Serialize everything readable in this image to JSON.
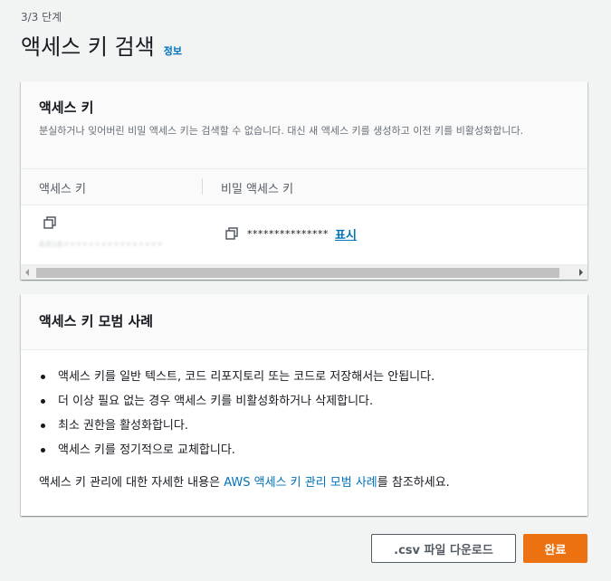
{
  "header": {
    "step": "3/3 단계",
    "title": "액세스 키 검색",
    "info_link": "정보"
  },
  "access_key_card": {
    "title": "액세스 키",
    "description": "분실하거나 잊어버린 비밀 액세스 키는 검색할 수 없습니다. 대신 새 액세스 키를 생성하고 이전 키를 비활성화합니다.",
    "columns": [
      "액세스 키",
      "비밀 액세스 키"
    ],
    "row": {
      "access_key": "AKIA••••••••••••••••",
      "secret_key_mask": "***************",
      "show_label": "표시"
    }
  },
  "best_practices_card": {
    "title": "액세스 키 모범 사례",
    "items": [
      "액세스 키를 일반 텍스트, 코드 리포지토리 또는 코드로 저장해서는 안됩니다.",
      "더 이상 필요 없는 경우 액세스 키를 비활성화하거나 삭제합니다.",
      "최소 권한을 활성화합니다.",
      "액세스 키를 정기적으로 교체합니다."
    ],
    "footer_prefix": "액세스 키 관리에 대한 자세한 내용은 ",
    "footer_link": "AWS 액세스 키 관리 모범 사례",
    "footer_suffix": "를 참조하세요."
  },
  "buttons": {
    "download_csv": ".csv 파일 다운로드",
    "done": "완료"
  },
  "icons": {
    "copy": "copy-icon",
    "scroll_left": "chevron-left-icon",
    "scroll_right": "chevron-right-icon"
  },
  "colors": {
    "link": "#0073bb",
    "primary_button": "#ec7211",
    "background": "#f2f3f3"
  }
}
